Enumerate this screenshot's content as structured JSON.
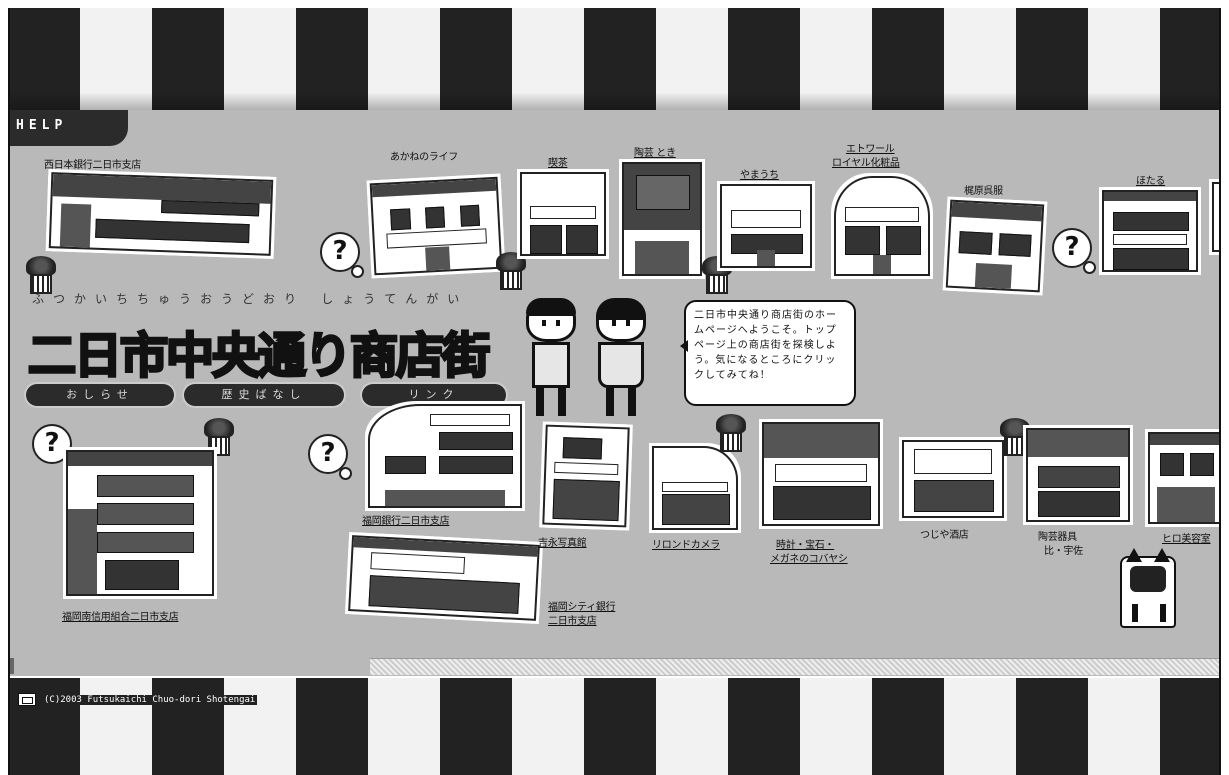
{
  "help": {
    "label": "HELP"
  },
  "title": {
    "main": "二日市中央通り商店街",
    "ruby": "ふつかいちちゅうおうどおり しょうてんがい"
  },
  "nav": {
    "announcements": "おしらせ",
    "history": "歴史ばなし",
    "links": "リンク"
  },
  "speech_bubble": {
    "text": "二日市中央通り商店街のホームページへようこそ。トップページ上の商店街を探検しよう。気になるところにクリックしてみてね！"
  },
  "shops_top": [
    {
      "label": "西日本銀行二日市支店"
    },
    {
      "label": "あかねのライフ"
    },
    {
      "label": "喫茶"
    },
    {
      "label": "陶芸 とき"
    },
    {
      "label": "やまうち"
    },
    {
      "label": "エトワール"
    },
    {
      "label": "ロイヤル化粧品"
    },
    {
      "label": "梶原呉服"
    },
    {
      "label": "ほたる"
    }
  ],
  "shops_bottom": [
    {
      "label": "福岡南信用組合二日市支店"
    },
    {
      "label": "福岡銀行二日市支店"
    },
    {
      "label": "福岡シティ銀行"
    },
    {
      "label": "二日市支店"
    },
    {
      "label": "吉永写真館"
    },
    {
      "label": "リロンドカメラ"
    },
    {
      "label": "時計・宝石・"
    },
    {
      "label": "メガネのコバヤシ"
    },
    {
      "label": "つじや酒店"
    },
    {
      "label": "陶芸器具"
    },
    {
      "label": "比・宇佐"
    },
    {
      "label": "ヒロ美容室"
    }
  ],
  "footer": {
    "copyright": "(C)2003 Futsukaichi Chuo-dori Shotengai"
  },
  "colors": {
    "bg_gray": "#b9b9b9",
    "stripe_dark": "#222222",
    "stripe_light": "#f2f2f2"
  }
}
